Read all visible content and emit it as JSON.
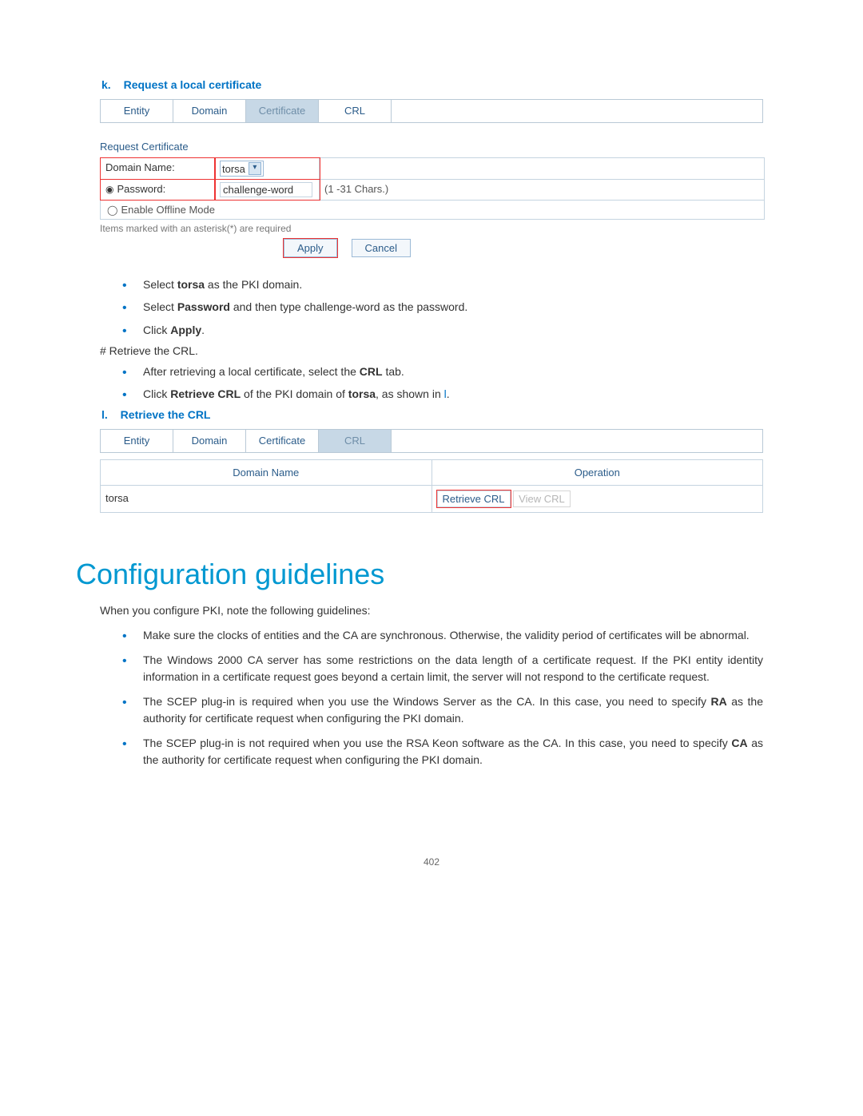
{
  "step_k": {
    "letter": "k.",
    "title": "Request a local certificate"
  },
  "tabs1": {
    "entity": "Entity",
    "domain": "Domain",
    "certificate": "Certificate",
    "crl": "CRL"
  },
  "req": {
    "link": "Request Certificate",
    "dn_label": "Domain Name:",
    "dn_value": "torsa",
    "pw_label": "Password:",
    "pw_value": "challenge-word",
    "pw_hint": "(1 -31 Chars.)",
    "offline": "Enable Offline Mode",
    "note": "Items marked with an asterisk(*) are required",
    "apply": "Apply",
    "cancel": "Cancel"
  },
  "bullets_k": {
    "b1a": "Select ",
    "b1b": "torsa",
    "b1c": " as the PKI domain.",
    "b2a": "Select ",
    "b2b": "Password",
    "b2c": " and then type challenge-word as the password.",
    "b3a": "Click ",
    "b3b": "Apply",
    "b3c": "."
  },
  "hash": "# Retrieve the CRL.",
  "bullets_crl": {
    "b1a": "After retrieving a local certificate, select the ",
    "b1b": "CRL",
    "b1c": " tab.",
    "b2a": "Click ",
    "b2b": "Retrieve CRL",
    "b2c": " of the PKI domain of ",
    "b2d": "torsa",
    "b2e": ", as shown in ",
    "b2f": "l",
    "b2g": "."
  },
  "step_l": {
    "letter": "l.",
    "title": "Retrieve the CRL"
  },
  "tabs2": {
    "entity": "Entity",
    "domain": "Domain",
    "certificate": "Certificate",
    "crl": "CRL"
  },
  "crl_table": {
    "h_dn": "Domain Name",
    "h_op": "Operation",
    "row_dn": "torsa",
    "retrieve": "Retrieve CRL",
    "view": "View CRL"
  },
  "h1": "Configuration guidelines",
  "intro": "When you configure PKI, note the following guidelines:",
  "guides": {
    "g1": "Make sure the clocks of entities and the CA are synchronous. Otherwise, the validity period of certificates will be abnormal.",
    "g2": "The Windows 2000 CA server has some restrictions on the data length of a certificate request. If the PKI entity identity information in a certificate request goes beyond a certain limit, the server will not respond to the certificate request.",
    "g3a": "The SCEP plug-in is required when you use the Windows Server as the CA. In this case, you need to specify ",
    "g3b": "RA",
    "g3c": " as the authority for certificate request when configuring the PKI domain.",
    "g4a": "The SCEP plug-in is not required when you use the RSA Keon software as the CA. In this case, you need to specify ",
    "g4b": "CA",
    "g4c": " as the authority for certificate request when configuring the PKI domain."
  },
  "page": "402"
}
